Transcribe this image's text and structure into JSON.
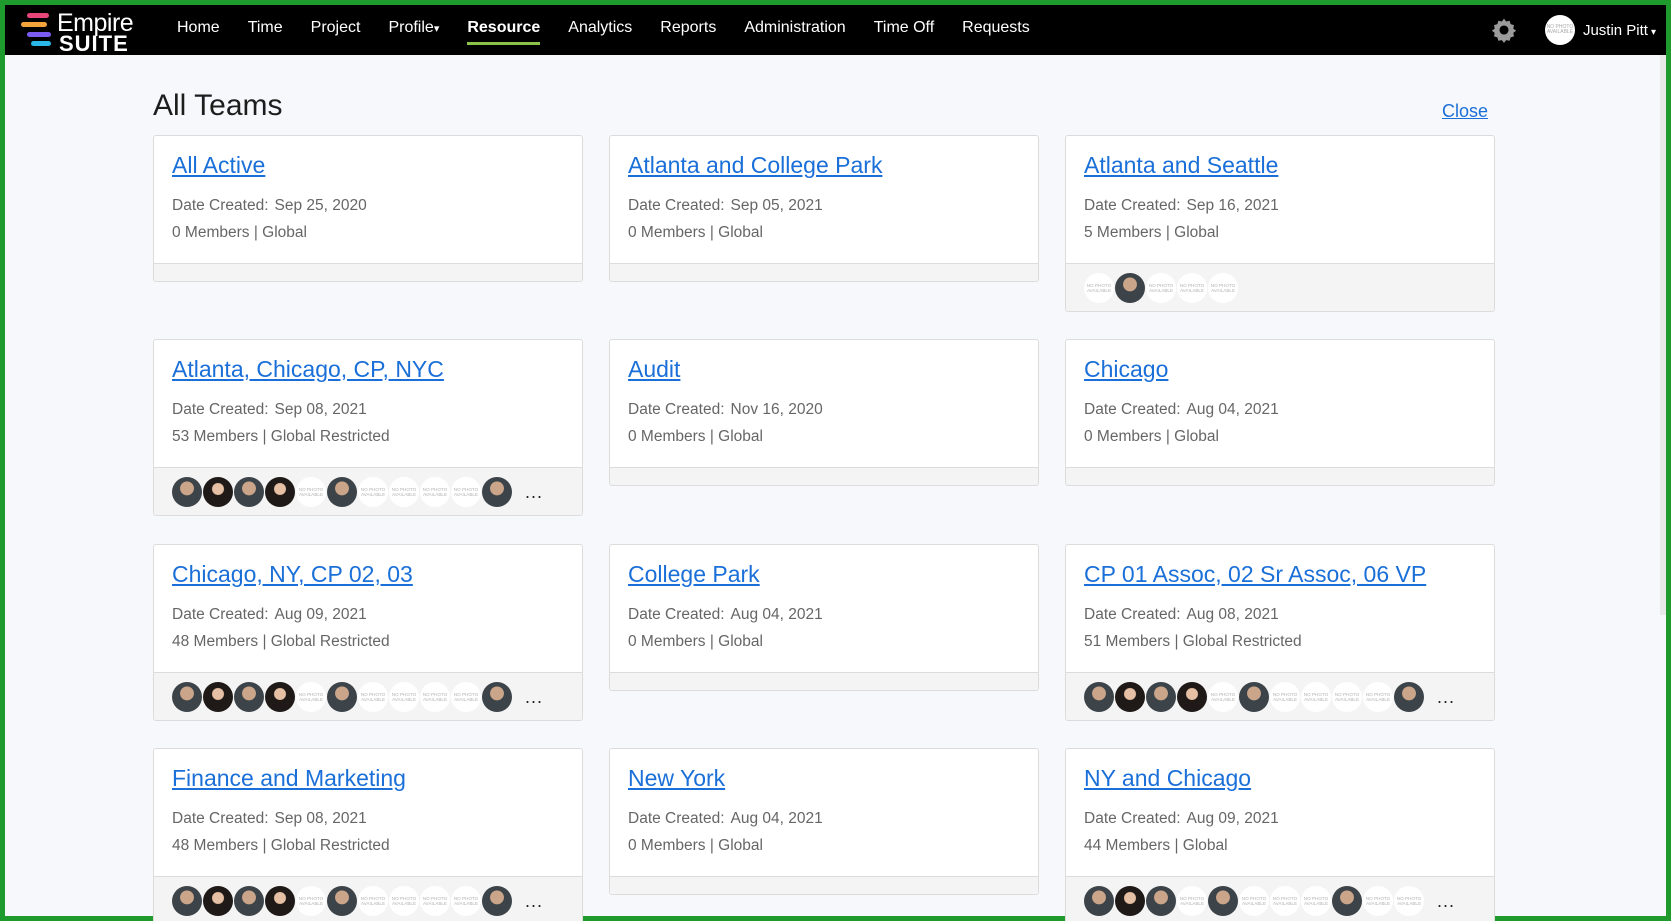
{
  "app": {
    "logo_line1": "Empire",
    "logo_line2": "SUITE"
  },
  "nav": {
    "items": [
      {
        "label": "Home",
        "active": false
      },
      {
        "label": "Time",
        "active": false
      },
      {
        "label": "Project",
        "active": false
      },
      {
        "label": "Profile",
        "active": false,
        "caret": "▾"
      },
      {
        "label": "Resource",
        "active": true
      },
      {
        "label": "Analytics",
        "active": false
      },
      {
        "label": "Reports",
        "active": false
      },
      {
        "label": "Administration",
        "active": false
      },
      {
        "label": "Time Off",
        "active": false
      },
      {
        "label": "Requests",
        "active": false
      }
    ]
  },
  "user": {
    "name": "Justin Pitt",
    "caret": "▾",
    "avatar_text": "NO PHOTO AVAILABLE"
  },
  "page": {
    "title": "All Teams",
    "close_label": "Close"
  },
  "labels": {
    "date_created": "Date Created:",
    "no_photo": "NO PHOTO AVAILABLE",
    "more": "..."
  },
  "teams": [
    {
      "name": "All Active",
      "date": "Sep 25, 2020",
      "members": "0 Members | Global",
      "avatars": [],
      "more": false
    },
    {
      "name": "Atlanta and College Park",
      "date": "Sep 05, 2021",
      "members": "0 Members | Global",
      "avatars": [],
      "more": false
    },
    {
      "name": "Atlanta and Seattle",
      "date": "Sep 16, 2021",
      "members": "5 Members | Global",
      "avatars": [
        "n",
        "p",
        "n",
        "n",
        "n"
      ],
      "more": false
    },
    {
      "name": "Atlanta, Chicago, CP, NYC",
      "date": "Sep 08, 2021",
      "members": "53 Members | Global Restricted",
      "avatars": [
        "p",
        "f",
        "p",
        "f",
        "n",
        "p",
        "n",
        "n",
        "n",
        "n",
        "p"
      ],
      "more": true
    },
    {
      "name": "Audit",
      "date": "Nov 16, 2020",
      "members": "0 Members | Global",
      "avatars": [],
      "more": false
    },
    {
      "name": "Chicago",
      "date": "Aug 04, 2021",
      "members": "0 Members | Global",
      "avatars": [],
      "more": false
    },
    {
      "name": "Chicago, NY, CP 02, 03",
      "date": "Aug 09, 2021",
      "members": "48 Members | Global Restricted",
      "avatars": [
        "p",
        "f",
        "p",
        "f",
        "n",
        "p",
        "n",
        "n",
        "n",
        "n",
        "p"
      ],
      "more": true
    },
    {
      "name": "College Park",
      "date": "Aug 04, 2021",
      "members": "0 Members | Global",
      "avatars": [],
      "more": false
    },
    {
      "name": "CP 01 Assoc, 02 Sr Assoc, 06 VP",
      "date": "Aug 08, 2021",
      "members": "51 Members | Global Restricted",
      "avatars": [
        "p",
        "f",
        "p",
        "f",
        "n",
        "p",
        "n",
        "n",
        "n",
        "n",
        "p"
      ],
      "more": true
    },
    {
      "name": "Finance and Marketing",
      "date": "Sep 08, 2021",
      "members": "48 Members | Global Restricted",
      "avatars": [
        "p",
        "f",
        "p",
        "f",
        "n",
        "p",
        "n",
        "n",
        "n",
        "n",
        "p"
      ],
      "more": true
    },
    {
      "name": "New York",
      "date": "Aug 04, 2021",
      "members": "0 Members | Global",
      "avatars": [],
      "more": false
    },
    {
      "name": "NY and Chicago",
      "date": "Aug 09, 2021",
      "members": "44 Members | Global",
      "avatars": [
        "p",
        "f",
        "p",
        "n",
        "p",
        "n",
        "n",
        "n",
        "p",
        "n",
        "n"
      ],
      "more": true
    }
  ]
}
